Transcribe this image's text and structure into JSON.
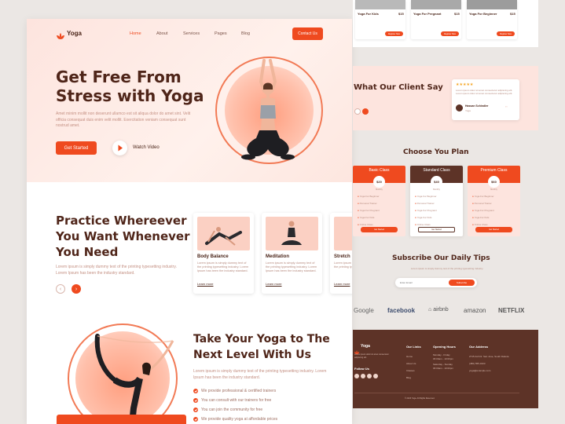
{
  "nav": {
    "logo": "Yoga",
    "links": [
      "Home",
      "About",
      "Services",
      "Pages",
      "Blog"
    ],
    "contact": "Contact Us"
  },
  "hero": {
    "title_line1": "Get Free From",
    "title_line2": "Stress with Yoga",
    "paragraph": "Amet minim mollit non deserunt ullamco est sit aliqua dolor do amet sint. Velit officia consequat duis enim velit mollit. Exercitation veniam consequat sunt nostrud amet.",
    "cta": "Get Started",
    "video": "Watch Video"
  },
  "practice": {
    "title_line1": "Practice Whereever",
    "title_line2": "You Want Whenever",
    "title_line3": "You Need",
    "paragraph": "Lorem ipsum is simply dummy text of the printing typesetting industry. Lorem Ipsum has been the industry standard.",
    "cards": [
      {
        "title": "Body Balance",
        "desc": "Lorem ipsum is simply dummy text of the printing typesetting industry. Lorem Ipsum has been the industry standard.",
        "link": "Learn more"
      },
      {
        "title": "Meditation",
        "desc": "Lorem ipsum is simply dummy text of the printing typesetting industry. Lorem Ipsum has been the industry standard.",
        "link": "Learn more"
      },
      {
        "title": "Stretch",
        "desc": "Lorem ipsum is simply dummy text of the printing typesetting industry.",
        "link": "Learn more"
      }
    ]
  },
  "next": {
    "title_line1": "Take Your Yoga to The",
    "title_line2": "Next Level With Us",
    "paragraph": "Lorem ipsum is simply dummy text of the printing typesetting industry. Lorem Ipsum has been the industry standard.",
    "features": [
      "We provide professional & certified trainers",
      "You can consult with our trainers for free",
      "You can join the community for free",
      "We provide quality yoga at affordable prices"
    ]
  },
  "programs": [
    {
      "title": "Yoga For Kids",
      "price": "$15",
      "button": "Register Now"
    },
    {
      "title": "Yoga For Pregnant",
      "price": "$15",
      "button": "Register Now"
    },
    {
      "title": "Yoga For Beginner",
      "price": "$15",
      "button": "Register Now"
    }
  ],
  "testimonial": {
    "title": "What Our Client Say",
    "stars": "★★★★★",
    "quote": "Lorem ipsum dolor sit amet consectetur adipiscing elit. Lorem ipsum dolor sit amet consectetur adipiscing elit.",
    "name": "Hassan Schindler",
    "role": "Yoga"
  },
  "plans": {
    "title": "Choose You Plan",
    "items": [
      {
        "name": "Basic Class",
        "price": "$20",
        "period": "Monthly",
        "button": "Get Started"
      },
      {
        "name": "Standard Class",
        "price": "$40",
        "period": "Monthly",
        "button": "Get Started"
      },
      {
        "name": "Premium Class",
        "price": "$60",
        "period": "Monthly",
        "button": "Get Started"
      }
    ],
    "features": [
      "Yoga For Beginner",
      "Personal Trainer",
      "Yoga For Pregnant",
      "Yoga For Kids",
      "Online Class"
    ]
  },
  "subscribe": {
    "title": "Subscribe Our Daily Tips",
    "paragraph": "Lorem ipsum is simply dummy text of the printing typesetting industry.",
    "placeholder": "Enter Email",
    "button": "Subscribe"
  },
  "brands": [
    "Google",
    "facebook",
    "airbnb",
    "amazon",
    "NETFLIX"
  ],
  "footer": {
    "logo": "Yoga",
    "about": "Lorem ipsum dolor sit amet consectetur adipiscing elit.",
    "follow": "Follow Us",
    "links_title": "Our Links",
    "links": [
      "Home",
      "About Us",
      "Classes",
      "Blog"
    ],
    "hours_title": "Opening Hours",
    "hours": [
      "Monday - Friday",
      "06:00am - 10:00pm",
      "Saturday - Sunday",
      "06:00am - 10:00pm"
    ],
    "address_title": "Our Address",
    "address": [
      "2715 Ash Dr. San Jose, South Dakota",
      "(480) 555-0103",
      "yoga@example.com"
    ],
    "copyright": "© 2023 Yoga. All Rights Reserved."
  },
  "colors": {
    "accent": "#ef4a1f",
    "brown": "#5d3327",
    "hero_bg": "#fde4de"
  }
}
